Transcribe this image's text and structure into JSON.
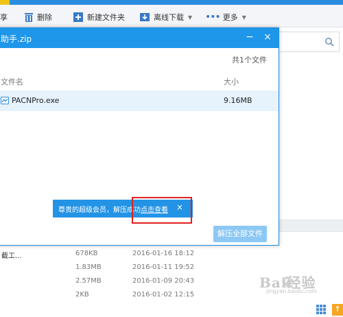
{
  "toolbar": {
    "item1": "享",
    "delete": "删除",
    "new_folder": "新建文件夹",
    "offline_download": "离线下载",
    "more": "更多"
  },
  "dialog": {
    "title": "助手.zip",
    "minimize": "−",
    "close": "×",
    "count": "共1个文件",
    "columns": {
      "name": "文件名",
      "size": "大小"
    },
    "files": [
      {
        "name": "PACNPro.exe",
        "size": "9.16MB"
      }
    ],
    "toast": {
      "message": "尊贵的超级会员，解压成功",
      "link": "点击查看",
      "close": "×"
    },
    "extract_all": "解压全部文件"
  },
  "background_files": [
    {
      "name": "截工...",
      "size": "678KB",
      "date": "2016-01-16 18:12"
    },
    {
      "name": "",
      "size": "1.83MB",
      "date": "2016-01-11 19:52"
    },
    {
      "name": "",
      "size": "2.57MB",
      "date": "2016-01-09 20:43"
    },
    {
      "name": "",
      "size": "2KB",
      "date": "2016-01-02 12:15"
    }
  ],
  "watermark": {
    "main": "Bai经验",
    "sub": "jingyan.baidu.com"
  },
  "colors": {
    "accent": "#1e96ea",
    "highlight": "#e0201e",
    "selected_row": "#e6f2fc",
    "disabled_button": "#8cc8f4"
  }
}
